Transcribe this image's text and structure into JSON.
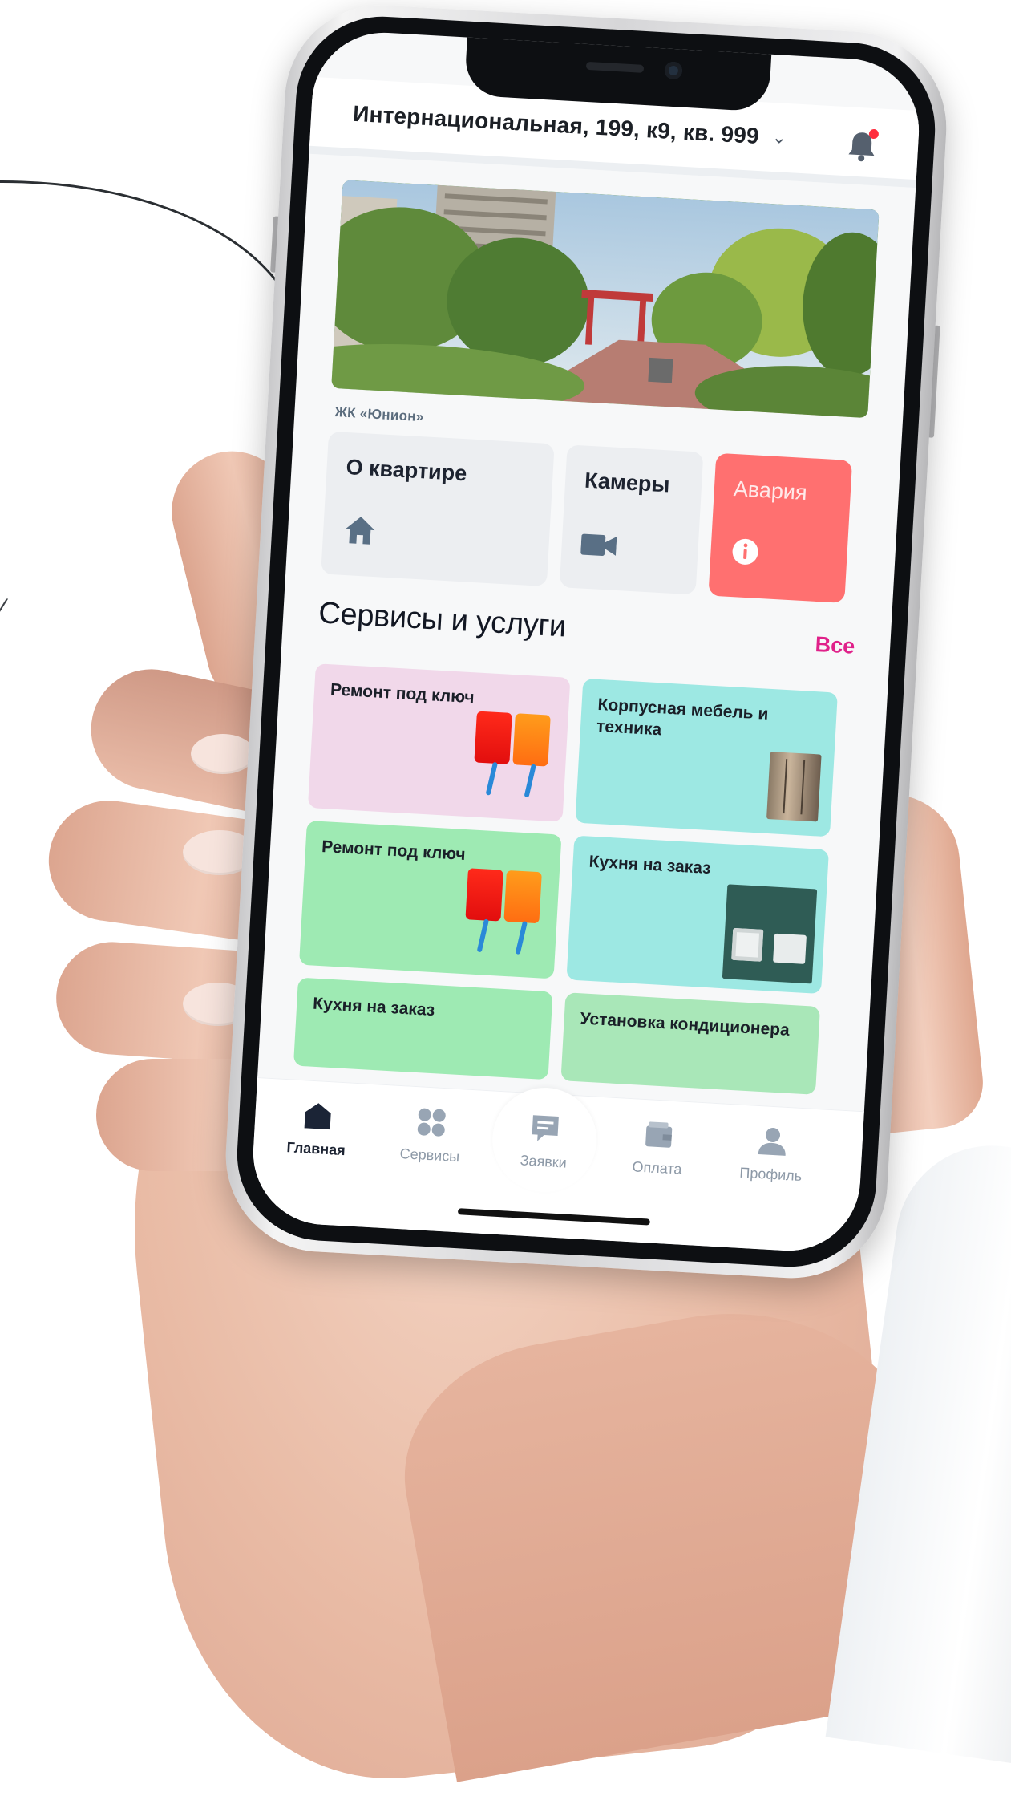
{
  "header": {
    "address": "Интернациональная, 199, к9, кв. 999",
    "chevron_icon": "chevron-down-icon",
    "bell_icon": "bell-icon"
  },
  "complex": {
    "name": "ЖК «Юнион»"
  },
  "quick_tiles": [
    {
      "label": "О квартире",
      "icon": "home-icon"
    },
    {
      "label": "Камеры",
      "icon": "video-camera-icon"
    },
    {
      "label": "Авария",
      "icon": "info-icon"
    }
  ],
  "services": {
    "title": "Сервисы и услуги",
    "all_label": "Все",
    "items": [
      {
        "label": "Ремонт под ключ"
      },
      {
        "label": "Корпусная мебель и техника"
      },
      {
        "label": "Ремонт под ключ"
      },
      {
        "label": "Кухня на заказ"
      },
      {
        "label": "Кухня на заказ"
      },
      {
        "label": "Установка кондиционера"
      }
    ]
  },
  "tabbar": {
    "tabs": [
      {
        "label": "Главная",
        "icon": "home-icon",
        "active": true
      },
      {
        "label": "Сервисы",
        "icon": "grid-icon",
        "active": false
      },
      {
        "label": "Заявки",
        "icon": "chat-icon",
        "active": false
      },
      {
        "label": "Оплата",
        "icon": "wallet-icon",
        "active": false
      },
      {
        "label": "Профиль",
        "icon": "user-icon",
        "active": false
      }
    ]
  },
  "colors": {
    "accent_pink": "#e0218a",
    "alarm_red": "#ff7070",
    "tile_gray": "#eceef1",
    "service_pink": "#f1d8ea",
    "service_cyan": "#9de8e3",
    "service_green": "#9eeab3"
  }
}
